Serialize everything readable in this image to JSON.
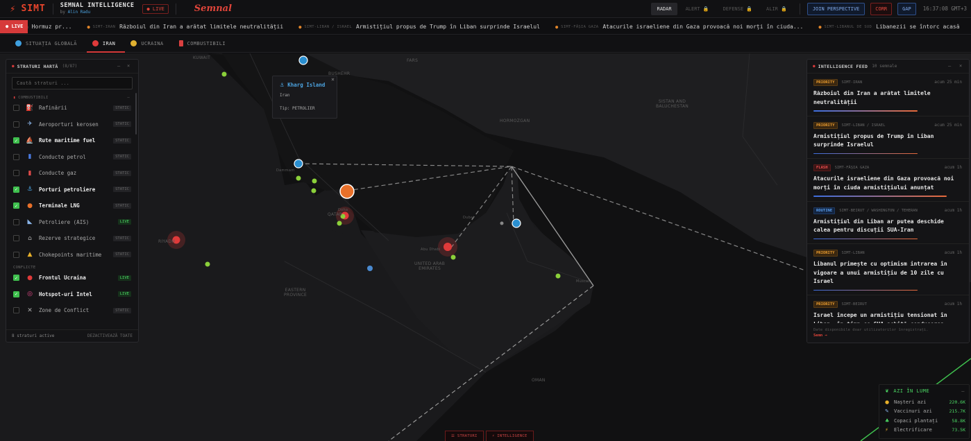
{
  "header": {
    "logo": "SIMT",
    "brand_name": "SEMNAL INTELLIGENCE",
    "brand_by_prefix": "by",
    "brand_author": "Alin Radu",
    "live_label": "LIVE",
    "semnal": "Semnal",
    "modes": [
      {
        "label": "RADAR",
        "active": true
      },
      {
        "label": "ALERT",
        "active": false
      },
      {
        "label": "DEFENSE",
        "active": false
      },
      {
        "label": "ALIR",
        "active": false
      }
    ],
    "join_label": "JOIN PERSPECTIVE",
    "corr_label": "CORR",
    "gap_label": "GAP",
    "clock": "16:37:08 GMT+3"
  },
  "ticker": {
    "live_label": "LIVE",
    "items": [
      {
        "tag": "",
        "text": "a Hormuz pr..."
      },
      {
        "tag": "SIMT-IRAN",
        "text": "Războiul din Iran a arătat limitele neutralității"
      },
      {
        "tag": "SIMT-LIBAN / ISRAEL",
        "text": "Armistițiul propus de Trump în Liban surprinde Israelul"
      },
      {
        "tag": "SIMT-FÂȘIA GAZA",
        "text": "Atacurile israeliene din Gaza provoacă noi morți în ciuda..."
      },
      {
        "tag": "SIMT-LIBANUL DE SUD",
        "text": "Libanezii se întorc acasă"
      }
    ]
  },
  "region_tabs": [
    {
      "label": "SITUAȚIA GLOBALĂ",
      "color": "#3fa0e0",
      "active": false
    },
    {
      "label": "IRAN",
      "color": "#e03a3a",
      "active": true
    },
    {
      "label": "UCRAINA",
      "color": "#e0b030",
      "active": false
    },
    {
      "label": "COMBUSTIBILI",
      "color": "#d94040",
      "active": false
    }
  ],
  "layers": {
    "title": "STRATURI HARTĂ",
    "count": "(8/87)",
    "search_placeholder": "Caută straturi ...",
    "group_fuel": "COMBUSTIBILI",
    "group_conflict": "CONFLICTE",
    "items_fuel": [
      {
        "name": "Rafinării",
        "icon": "⛽",
        "icon_color": "#d94040",
        "checked": false,
        "badge": "STATIC"
      },
      {
        "name": "Aeroporturi kerosen",
        "icon": "✈",
        "icon_color": "#8ab4e8",
        "checked": false,
        "badge": "STATIC"
      },
      {
        "name": "Rute maritime fuel",
        "icon": "⛵",
        "icon_color": "#d0d0d0",
        "checked": true,
        "badge": "STATIC"
      },
      {
        "name": "Conducte petrol",
        "icon": "▮",
        "icon_color": "#4a7ae0",
        "checked": false,
        "badge": "STATIC"
      },
      {
        "name": "Conducte gaz",
        "icon": "▮",
        "icon_color": "#e04a4a",
        "checked": false,
        "badge": "STATIC"
      },
      {
        "name": "Porturi petroliere",
        "icon": "⚓",
        "icon_color": "#4ca3e0",
        "checked": true,
        "badge": "STATIC"
      },
      {
        "name": "Terminale LNG",
        "icon": "●",
        "icon_color": "#e8702a",
        "checked": true,
        "badge": "STATIC"
      },
      {
        "name": "Petroliere (AIS)",
        "icon": "◣",
        "icon_color": "#8ab4e8",
        "checked": false,
        "badge": "LIVE"
      },
      {
        "name": "Rezerve strategice",
        "icon": "⌂",
        "icon_color": "#aaaaaa",
        "checked": false,
        "badge": "STATIC"
      },
      {
        "name": "Chokepoints maritime",
        "icon": "▲",
        "icon_color": "#e8b02a",
        "checked": false,
        "badge": "STATIC"
      }
    ],
    "items_conflict": [
      {
        "name": "Frontul Ucraina",
        "icon": "●",
        "icon_color": "#e03a3a",
        "checked": true,
        "badge": "LIVE"
      },
      {
        "name": "Hotspot-uri Intel",
        "icon": "◎",
        "icon_color": "#e84a8a",
        "checked": true,
        "badge": "LIVE"
      },
      {
        "name": "Zone de Conflict",
        "icon": "✕",
        "icon_color": "#aaaaaa",
        "checked": false,
        "badge": "STATIC"
      }
    ],
    "footer_count": "8 straturi active",
    "footer_action": "DEZACTIVEAZĂ TOATE"
  },
  "popup": {
    "title": "Kharg Island",
    "country": "Iran",
    "type": "Tip: PETROLIER"
  },
  "map_labels": {
    "kuwait": "KUWAIT",
    "bushehr": "BUSHEHR",
    "fars": "FARS",
    "sistan": "SISTAN AND\nBALUCHESTAN",
    "hormozgan": "HORMOZGAN",
    "qatar": "QATAR",
    "riyadh": "RIYADH",
    "uae": "UNITED ARAB\nEMIRATES",
    "eastern": "EASTERN\nPROVINCE",
    "oman": "OMAN",
    "dammam": "Dammam",
    "doha": "Doha",
    "abudhabi": "Abu Dhabi",
    "dubai": "Dubai",
    "muscat": "Muscat"
  },
  "intel": {
    "title": "INTELLIGENCE FEED",
    "count": "10 semnale",
    "items": [
      {
        "badge": "PRIORITY",
        "level": "priority",
        "tag": "SIMT-IRAN",
        "time": "acum 25 min",
        "text": "Războiul din Iran a arătat limitele neutralității"
      },
      {
        "badge": "PRIORITY",
        "level": "priority",
        "tag": "SIMT-LIBAN / ISRAEL",
        "time": "acum 25 min",
        "text": "Armistițiul propus de Trump în Liban surprinde Israelul"
      },
      {
        "badge": "FLASH",
        "level": "flash",
        "tag": "SIMT-FÂȘIA GAZA",
        "time": "acum 1h",
        "text": "Atacurile israeliene din Gaza provoacă noi morți în ciuda armistițiului anunțat"
      },
      {
        "badge": "ROUTINE",
        "level": "routine",
        "tag": "SIMT-BEIRUT / WASHINGTON / TEHERAN",
        "time": "acum 1h",
        "text": "Armistițiul din Liban ar putea deschide calea pentru discuții SUA-Iran"
      },
      {
        "badge": "PRIORITY",
        "level": "priority",
        "tag": "SIMT-LIBAN",
        "time": "acum 1h",
        "text": "Libanul primește cu optimism intrarea în vigoare a unui armistițiu de 10 zile cu Israel"
      },
      {
        "badge": "PRIORITY",
        "level": "priority",
        "tag": "SIMT-BEIRUT",
        "time": "acum 1h",
        "text": "Israel începe un armistițiu tensionat în Liban, în timp ce SUA achită conducerea"
      }
    ],
    "footer_text": "Date disponibile doar utilizatorilor înregistrați.",
    "footer_link": "Semn →"
  },
  "stats": {
    "title": "AZI ÎN LUME",
    "rows": [
      {
        "icon": "●",
        "icon_color": "#e8b02a",
        "label": "Nașteri azi",
        "value": "220.6K"
      },
      {
        "icon": "✎",
        "icon_color": "#8ab4e8",
        "label": "Vaccinuri azi",
        "value": "215.7K"
      },
      {
        "icon": "♣",
        "icon_color": "#4cd964",
        "label": "Copaci plantați",
        "value": "58.8K"
      },
      {
        "icon": "⚡",
        "icon_color": "#e8b02a",
        "label": "Electrificare",
        "value": "73.5K"
      }
    ]
  },
  "bottom_tabs": {
    "layers": "☰ STRATURI",
    "intel": "⚡ INTELLIGENCE"
  }
}
